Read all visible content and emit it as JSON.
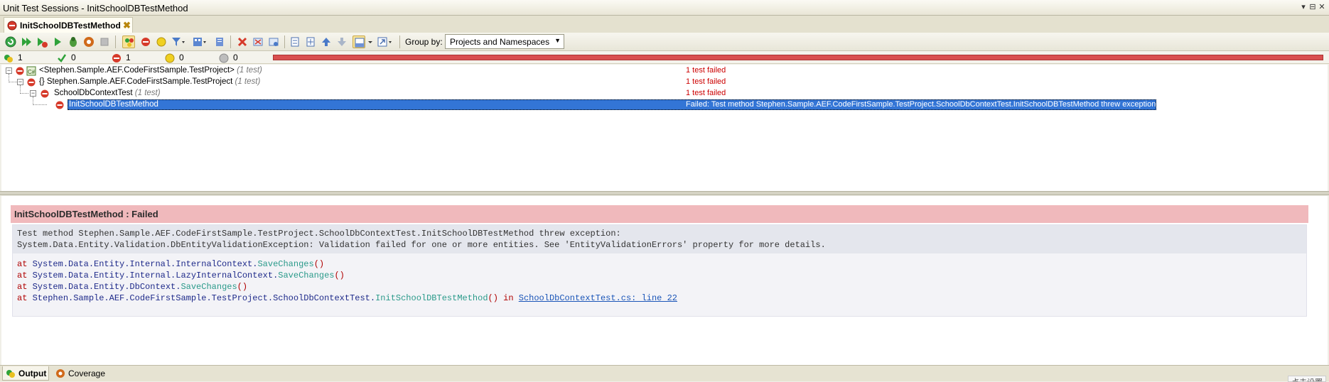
{
  "window": {
    "title": "Unit Test Sessions - InitSchoolDBTestMethod",
    "controls": [
      "pin-icon",
      "dock-icon",
      "close-icon"
    ]
  },
  "tab": {
    "label": "InitSchoolDBTestMethod"
  },
  "toolbar": {
    "group_by_label": "Group by:",
    "group_by_value": "Projects and Namespaces"
  },
  "counts": {
    "total": "1",
    "passed": "0",
    "failed": "1",
    "ignored": "0",
    "not_run": "0",
    "progress_failed_fraction": 1.0
  },
  "tree": {
    "rows": [
      {
        "name": "<Stephen.Sample.AEF.CodeFirstSample.TestProject>",
        "count": "(1 test)",
        "status": "1 test failed"
      },
      {
        "name": "{} Stephen.Sample.AEF.CodeFirstSample.TestProject",
        "count": "(1 test)",
        "status": "1 test failed"
      },
      {
        "name": "SchoolDbContextTest",
        "count": "(1 test)",
        "status": "1 test failed"
      },
      {
        "name": "InitSchoolDBTestMethod",
        "count": "",
        "status": "Failed: Test method Stephen.Sample.AEF.CodeFirstSample.TestProject.SchoolDbContextTest.InitSchoolDBTestMethod threw exception:"
      }
    ]
  },
  "details": {
    "header": "InitSchoolDBTestMethod : Failed",
    "message_line1": "Test method Stephen.Sample.AEF.CodeFirstSample.TestProject.SchoolDbContextTest.InitSchoolDBTestMethod threw exception:",
    "message_line2": "System.Data.Entity.Validation.DbEntityValidationException: Validation failed for one or more entities. See 'EntityValidationErrors' property for more details.",
    "stack": [
      {
        "at": "at",
        "ns": "System.Data.Entity.Internal.InternalContext.",
        "method": "SaveChanges",
        "parens": "()",
        "in": "",
        "link": ""
      },
      {
        "at": "at",
        "ns": "System.Data.Entity.Internal.LazyInternalContext.",
        "method": "SaveChanges",
        "parens": "()",
        "in": "",
        "link": ""
      },
      {
        "at": "at",
        "ns": "System.Data.Entity.DbContext.",
        "method": "SaveChanges",
        "parens": "()",
        "in": "",
        "link": ""
      },
      {
        "at": "at",
        "ns": "Stephen.Sample.AEF.CodeFirstSample.TestProject.SchoolDbContextTest.",
        "method": "InitSchoolDBTestMethod",
        "parens": "()",
        "in": " in ",
        "link": "SchoolDbContextTest.cs: line 22"
      }
    ]
  },
  "bottom_tabs": [
    {
      "label": "Output"
    },
    {
      "label": "Coverage"
    }
  ],
  "ime_text": "点击设置",
  "colors": {
    "failed": "#cc0000",
    "selection": "#3375d6",
    "detail_header": "#f0b9bc",
    "progress_fail": "#d94f4f"
  }
}
